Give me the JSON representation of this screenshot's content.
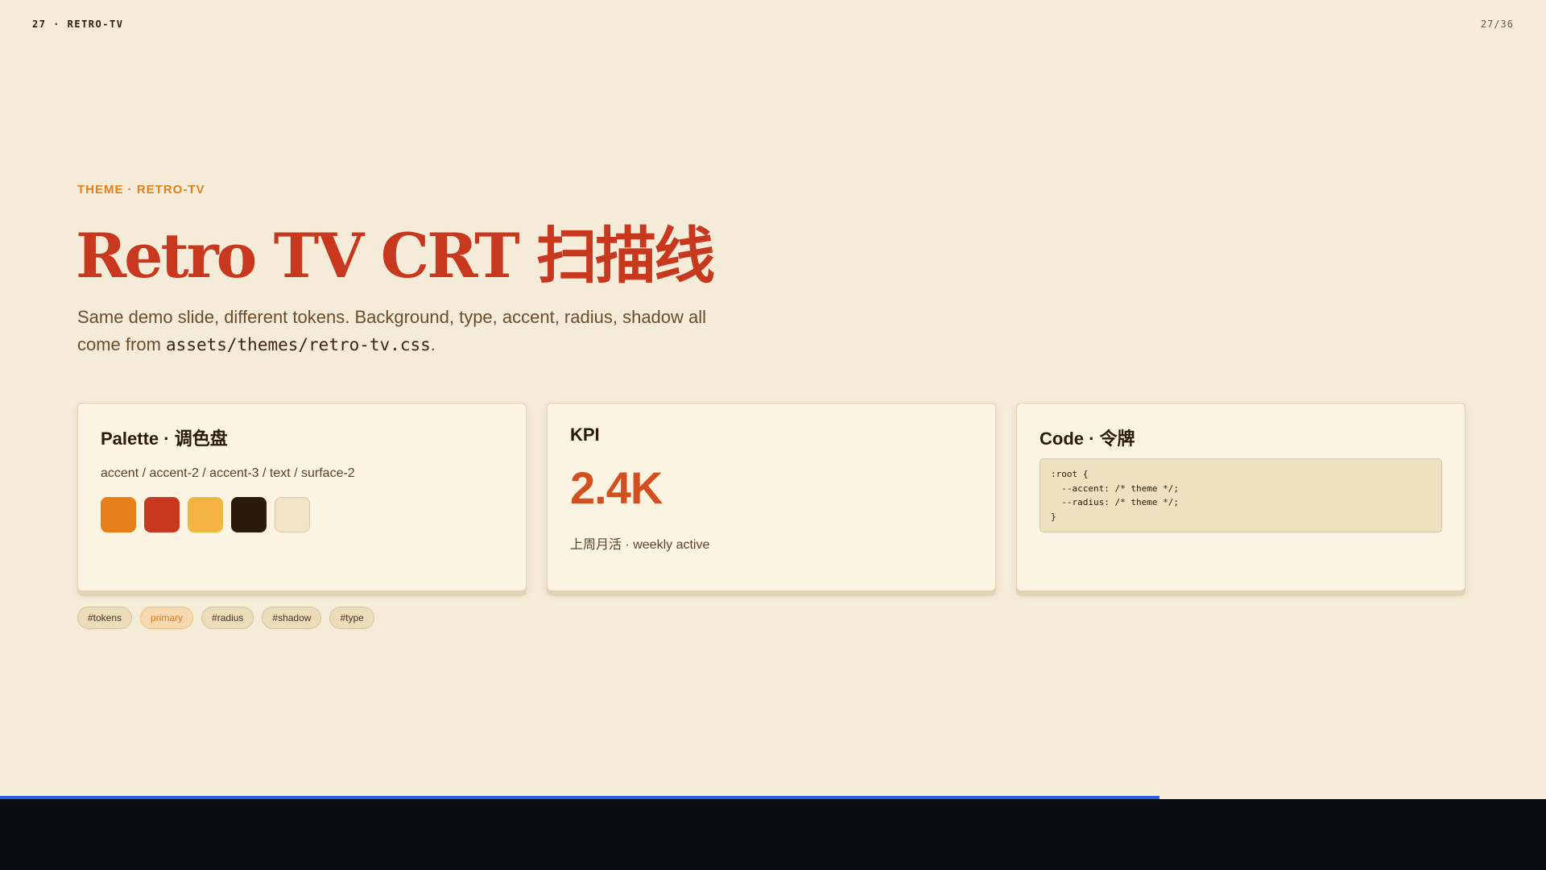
{
  "header": {
    "slide_label": "27 · RETRO-TV",
    "page_counter": "27/36"
  },
  "hero": {
    "eyebrow": "THEME · RETRO-TV",
    "title": "Retro TV CRT 扫描线",
    "lede_text": "Same demo slide, different tokens. Background, type, accent, radius, shadow all come from ",
    "lede_code": "assets/themes/retro-tv.css",
    "lede_end": "."
  },
  "cards": {
    "palette": {
      "title": "Palette · 调色盘",
      "subtitle": "accent / accent-2 / accent-3 / text / surface-2",
      "swatches": [
        {
          "name": "accent",
          "color": "#e8801a"
        },
        {
          "name": "accent-2",
          "color": "#c8381e"
        },
        {
          "name": "accent-3",
          "color": "#f2b544"
        },
        {
          "name": "text",
          "color": "#2a1a0c"
        },
        {
          "name": "surface-2",
          "color": "#f1e3c4"
        }
      ]
    },
    "kpi": {
      "title": "KPI",
      "value": "2.4K",
      "subtitle": "上周月活 · weekly active"
    },
    "code": {
      "title": "Code · 令牌",
      "snippet": ":root {\n  --accent: /* theme */;\n  --radius: /* theme */;\n}"
    }
  },
  "tags": [
    "#tokens",
    "primary",
    "#radius",
    "#shadow",
    "#type"
  ],
  "progress": {
    "value": 0.75,
    "color": "#2b5fe0"
  },
  "colors": {
    "background": "#f4ebd8",
    "accent": "#e2801d",
    "title": "#c7381e",
    "bottom_bar": "#0a0c12"
  }
}
